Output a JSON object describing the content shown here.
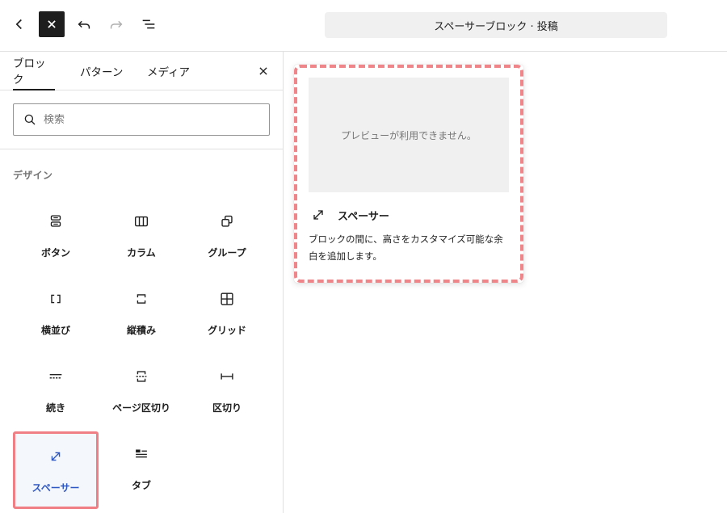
{
  "header": {
    "document_title": "スペーサーブロック · 投稿"
  },
  "inserter": {
    "tabs": [
      {
        "label": "ブロック",
        "active": true
      },
      {
        "label": "パターン",
        "active": false
      },
      {
        "label": "メディア",
        "active": false
      }
    ],
    "search": {
      "placeholder": "検索",
      "value": ""
    },
    "category": "デザイン",
    "blocks": [
      {
        "label": "ボタン",
        "icon": "buttons-icon"
      },
      {
        "label": "カラム",
        "icon": "columns-icon"
      },
      {
        "label": "グループ",
        "icon": "group-icon"
      },
      {
        "label": "横並び",
        "icon": "row-icon"
      },
      {
        "label": "縦積み",
        "icon": "stack-icon"
      },
      {
        "label": "グリッド",
        "icon": "grid-icon"
      },
      {
        "label": "続き",
        "icon": "more-icon"
      },
      {
        "label": "ページ区切り",
        "icon": "page-break-icon"
      },
      {
        "label": "区切り",
        "icon": "separator-icon"
      },
      {
        "label": "スペーサー",
        "icon": "spacer-icon",
        "selected": true
      },
      {
        "label": "タブ",
        "icon": "tabs-icon"
      }
    ]
  },
  "preview": {
    "placeholder": "プレビューが利用できません。",
    "name": "スペーサー",
    "description": "ブロックの間に、高さをカスタマイズ可能な余白を追加します。"
  },
  "colors": {
    "highlight_outline": "#ef7f84",
    "selected_label": "#2f57c2",
    "toolbar_active": "#1e1e1e"
  }
}
